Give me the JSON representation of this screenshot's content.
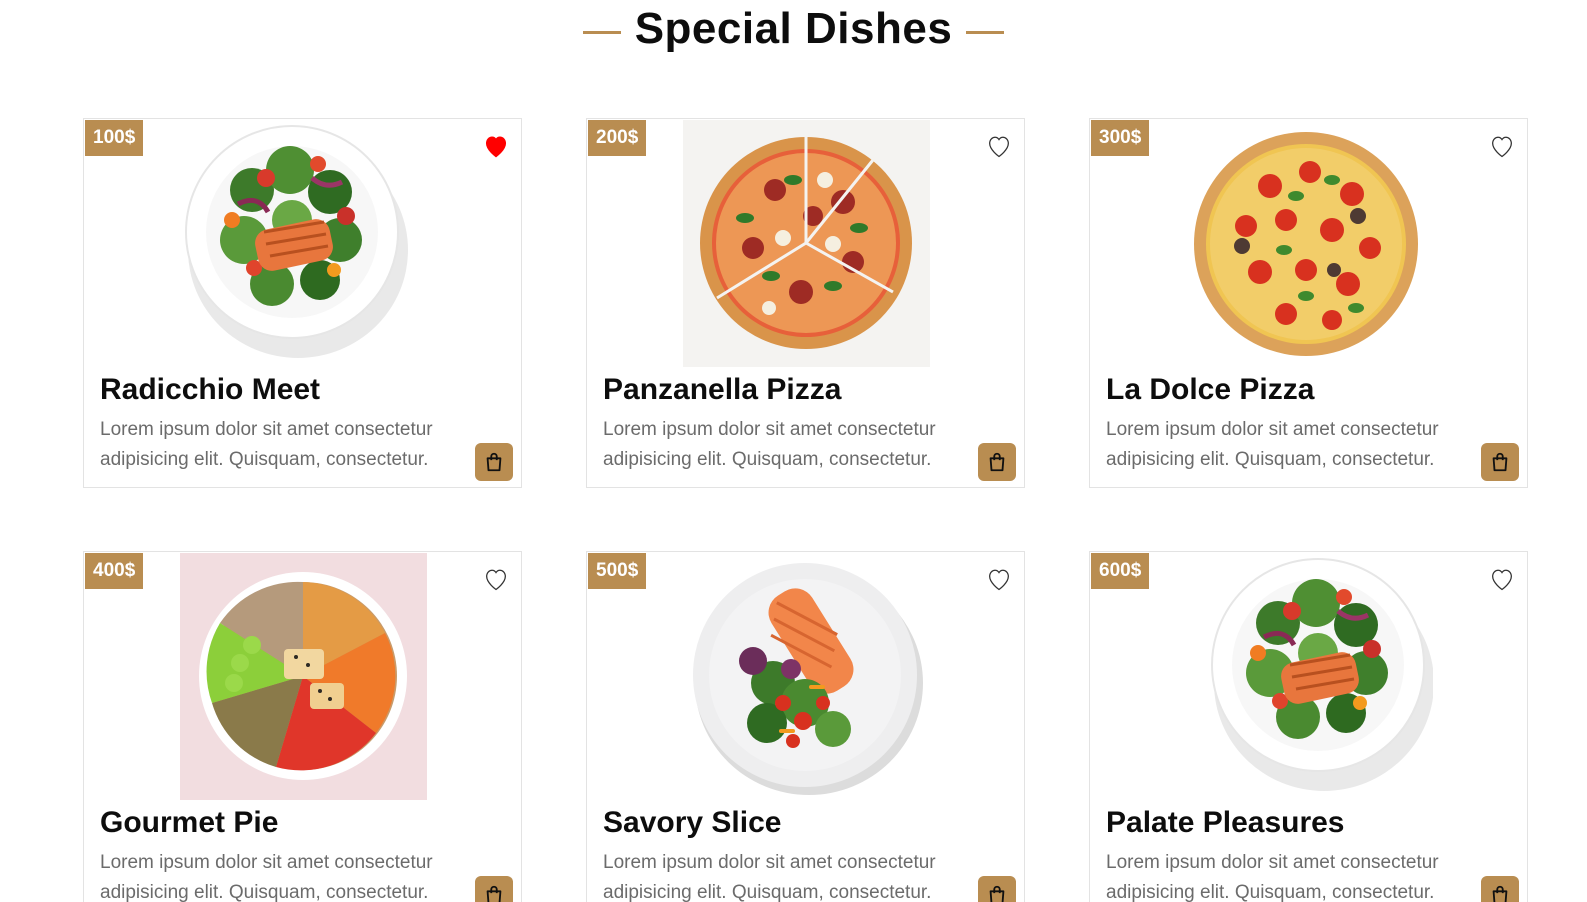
{
  "section": {
    "title": "Special Dishes"
  },
  "colors": {
    "accent": "#b98d51",
    "favorite_active": "#ff0000"
  },
  "cards": [
    {
      "price": "100$",
      "name": "Radicchio Meet",
      "description": "Lorem ipsum dolor sit amet consectetur adipisicing elit. Quisquam, consectetur.",
      "favorite": true,
      "image": "salmon-salad-plate"
    },
    {
      "price": "200$",
      "name": "Panzanella Pizza",
      "description": "Lorem ipsum dolor sit amet consectetur adipisicing elit. Quisquam, consectetur.",
      "favorite": false,
      "image": "sliced-vegetable-pizza"
    },
    {
      "price": "300$",
      "name": "La Dolce Pizza",
      "description": "Lorem ipsum dolor sit amet consectetur adipisicing elit. Quisquam, consectetur.",
      "favorite": false,
      "image": "pepperoni-pizza"
    },
    {
      "price": "400$",
      "name": "Gourmet Pie",
      "description": "Lorem ipsum dolor sit amet consectetur adipisicing elit. Quisquam, consectetur.",
      "favorite": false,
      "image": "poke-bowl"
    },
    {
      "price": "500$",
      "name": "Savory Slice",
      "description": "Lorem ipsum dolor sit amet consectetur adipisicing elit. Quisquam, consectetur.",
      "favorite": false,
      "image": "salmon-greens-plate"
    },
    {
      "price": "600$",
      "name": "Palate Pleasures",
      "description": "Lorem ipsum dolor sit amet consectetur adipisicing elit. Quisquam, consectetur.",
      "favorite": false,
      "image": "salmon-salad-plate"
    }
  ],
  "icons": {
    "favorite": "heart-icon",
    "cart": "shopping-bag-icon"
  }
}
